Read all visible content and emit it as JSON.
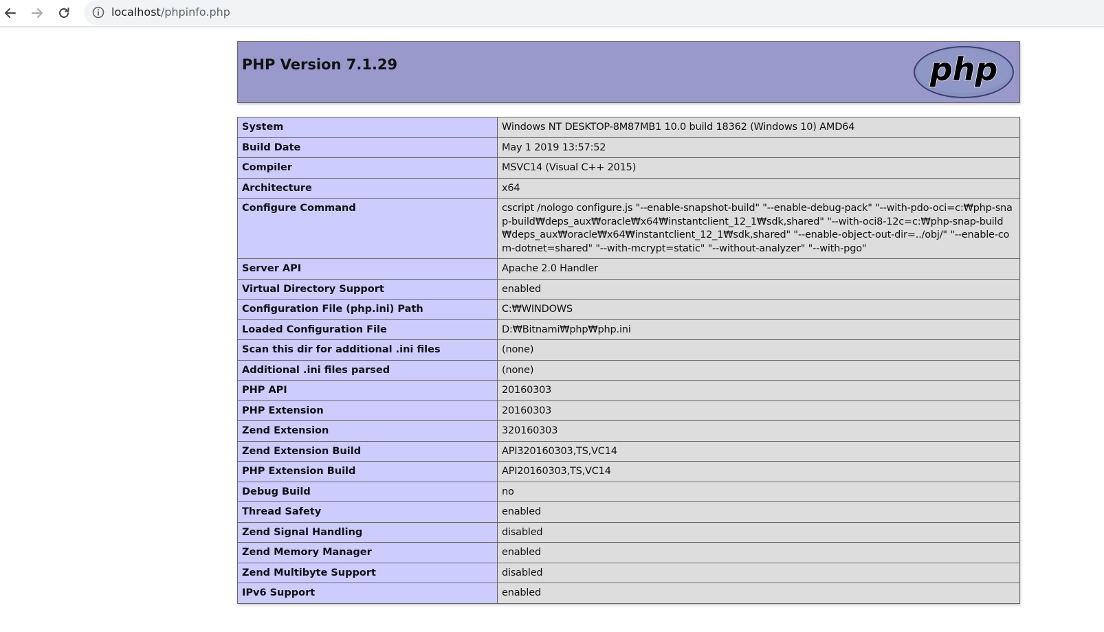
{
  "browser": {
    "url_host": "localhost",
    "url_path": "/phpinfo.php"
  },
  "header": {
    "title": "PHP Version 7.1.29",
    "logo_text": "php"
  },
  "colors": {
    "header_bg": "#9999cc",
    "key_cell_bg": "#ccccff",
    "value_cell_bg": "#dddddd"
  },
  "rows": [
    {
      "key": "System",
      "value": "Windows NT DESKTOP-8M87MB1 10.0 build 18362 (Windows 10) AMD64"
    },
    {
      "key": "Build Date",
      "value": "May 1 2019 13:57:52"
    },
    {
      "key": "Compiler",
      "value": "MSVC14 (Visual C++ 2015)"
    },
    {
      "key": "Architecture",
      "value": "x64"
    },
    {
      "key": "Configure Command",
      "value": "cscript /nologo configure.js \"--enable-snapshot-build\" \"--enable-debug-pack\" \"--with-pdo-oci=c:₩php-snap-build₩deps_aux₩oracle₩x64₩instantclient_12_1₩sdk,shared\" \"--with-oci8-12c=c:₩php-snap-build₩deps_aux₩oracle₩x64₩instantclient_12_1₩sdk,shared\" \"--enable-object-out-dir=../obj/\" \"--enable-com-dotnet=shared\" \"--with-mcrypt=static\" \"--without-analyzer\" \"--with-pgo\""
    },
    {
      "key": "Server API",
      "value": "Apache 2.0 Handler"
    },
    {
      "key": "Virtual Directory Support",
      "value": "enabled"
    },
    {
      "key": "Configuration File (php.ini) Path",
      "value": "C:₩WINDOWS"
    },
    {
      "key": "Loaded Configuration File",
      "value": "D:₩Bitnami₩php₩php.ini"
    },
    {
      "key": "Scan this dir for additional .ini files",
      "value": "(none)"
    },
    {
      "key": "Additional .ini files parsed",
      "value": "(none)"
    },
    {
      "key": "PHP API",
      "value": "20160303"
    },
    {
      "key": "PHP Extension",
      "value": "20160303"
    },
    {
      "key": "Zend Extension",
      "value": "320160303"
    },
    {
      "key": "Zend Extension Build",
      "value": "API320160303,TS,VC14"
    },
    {
      "key": "PHP Extension Build",
      "value": "API20160303,TS,VC14"
    },
    {
      "key": "Debug Build",
      "value": "no"
    },
    {
      "key": "Thread Safety",
      "value": "enabled"
    },
    {
      "key": "Zend Signal Handling",
      "value": "disabled"
    },
    {
      "key": "Zend Memory Manager",
      "value": "enabled"
    },
    {
      "key": "Zend Multibyte Support",
      "value": "disabled"
    },
    {
      "key": "IPv6 Support",
      "value": "enabled"
    }
  ]
}
